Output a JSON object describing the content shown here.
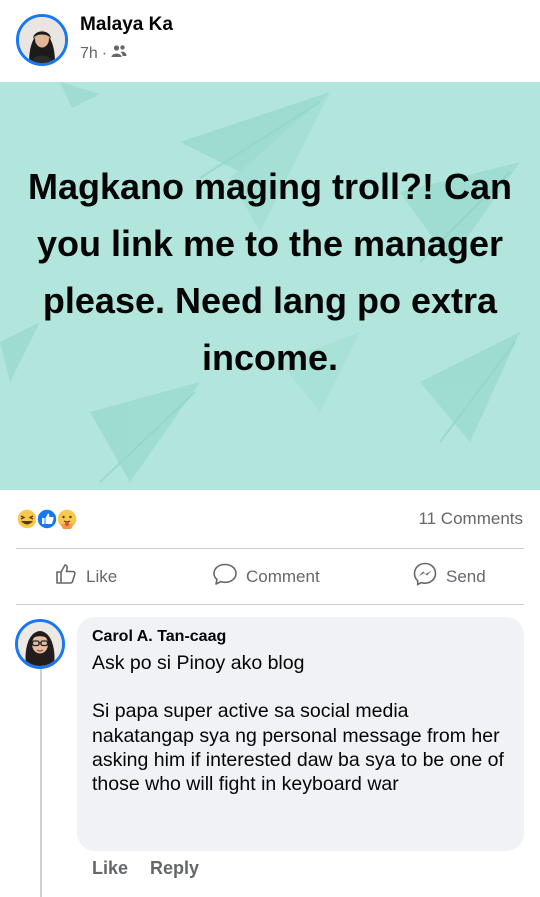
{
  "post": {
    "author": "Malaya Ka",
    "time": "7h",
    "separator": "·",
    "audience_icon": "friends-icon",
    "text": "Magkano maging troll?! Can you link me to the manager please. Need lang po extra income.",
    "background_color": "#b2e5dc"
  },
  "reactions": {
    "icons": [
      "haha-reaction-icon",
      "like-reaction-icon",
      "care-reaction-icon"
    ],
    "comments_count": "11 Comments"
  },
  "actions": {
    "like_label": "Like",
    "comment_label": "Comment",
    "send_label": "Send"
  },
  "comment": {
    "author": "Carol A. Tan-caag",
    "text": "Ask po si Pinoy ako blog\n\nSi papa super active sa social media nakatangap sya ng personal message from her asking him if interested daw ba sya to be one of those who will fight in keyboard war",
    "like_label": "Like",
    "reply_label": "Reply"
  },
  "colors": {
    "accent": "#1877f2",
    "secondary_text": "#65676b",
    "bubble": "#f0f2f5"
  }
}
